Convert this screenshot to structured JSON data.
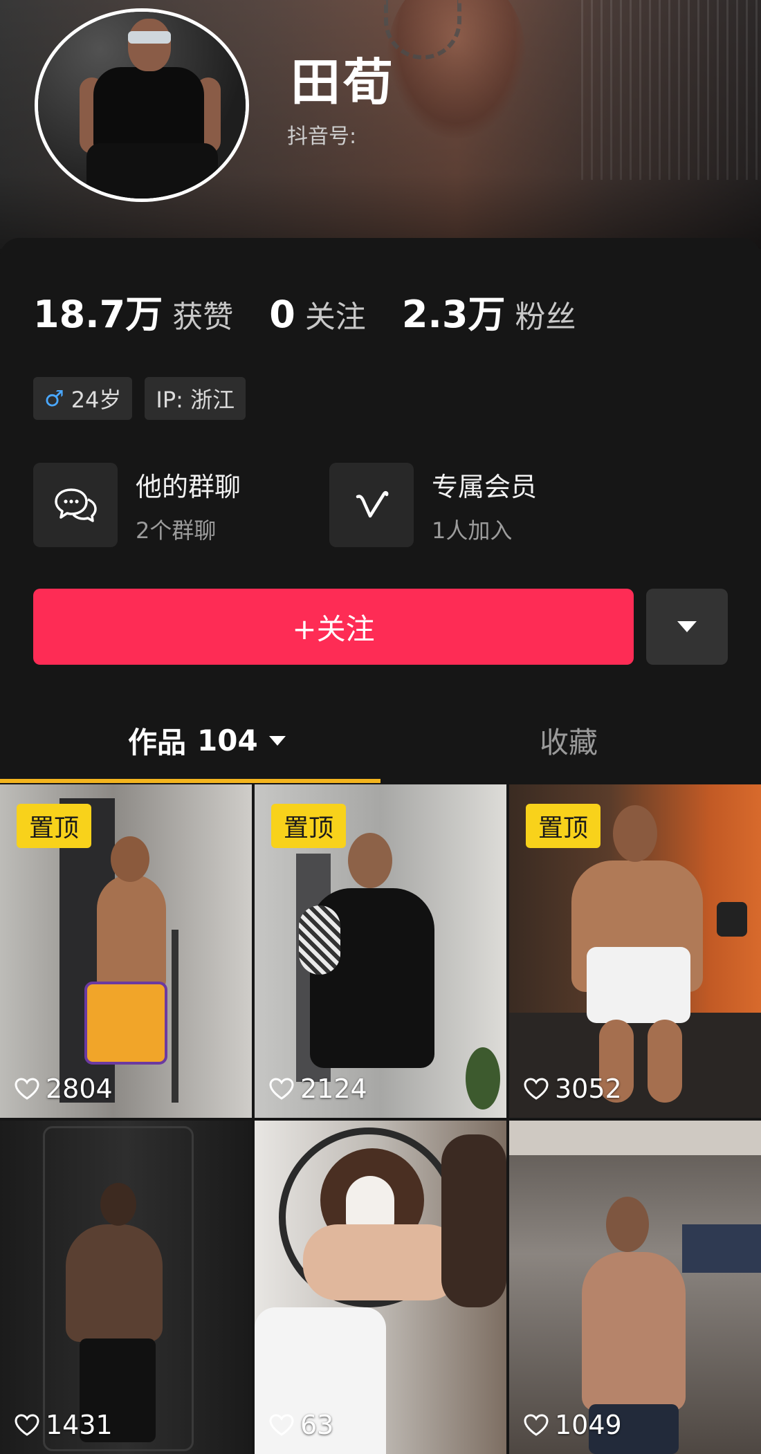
{
  "profile": {
    "name": "田荀",
    "douyin_id_label": "抖音号:"
  },
  "stats": [
    {
      "value": "18.7万",
      "label": "获赞"
    },
    {
      "value": "0",
      "label": "关注"
    },
    {
      "value": "2.3万",
      "label": "粉丝"
    }
  ],
  "tags": {
    "age": "24岁",
    "ip": "IP:  浙江"
  },
  "entries": {
    "group_chat": {
      "title": "他的群聊",
      "sub": "2个群聊",
      "icon": "chat-bubbles-icon"
    },
    "membership": {
      "title": "专属会员",
      "sub": "1人加入",
      "icon": "v-icon"
    }
  },
  "actions": {
    "follow_label": "+关注",
    "more_icon": "triangle-down-icon"
  },
  "tabs": {
    "works_label": "作品",
    "works_count": "104",
    "favorites_label": "收藏"
  },
  "videos": [
    {
      "pinned": "置顶",
      "likes": "2804"
    },
    {
      "pinned": "置顶",
      "likes": "2124"
    },
    {
      "pinned": "置顶",
      "likes": "3052"
    },
    {
      "pinned": "",
      "likes": "1431"
    },
    {
      "pinned": "",
      "likes": "63"
    },
    {
      "pinned": "",
      "likes": "1049"
    }
  ],
  "colors": {
    "follow": "#fe2c55",
    "pin": "#f8d21b",
    "tab_underline": "#f4b51e",
    "male_symbol": "#4aa8ff"
  }
}
